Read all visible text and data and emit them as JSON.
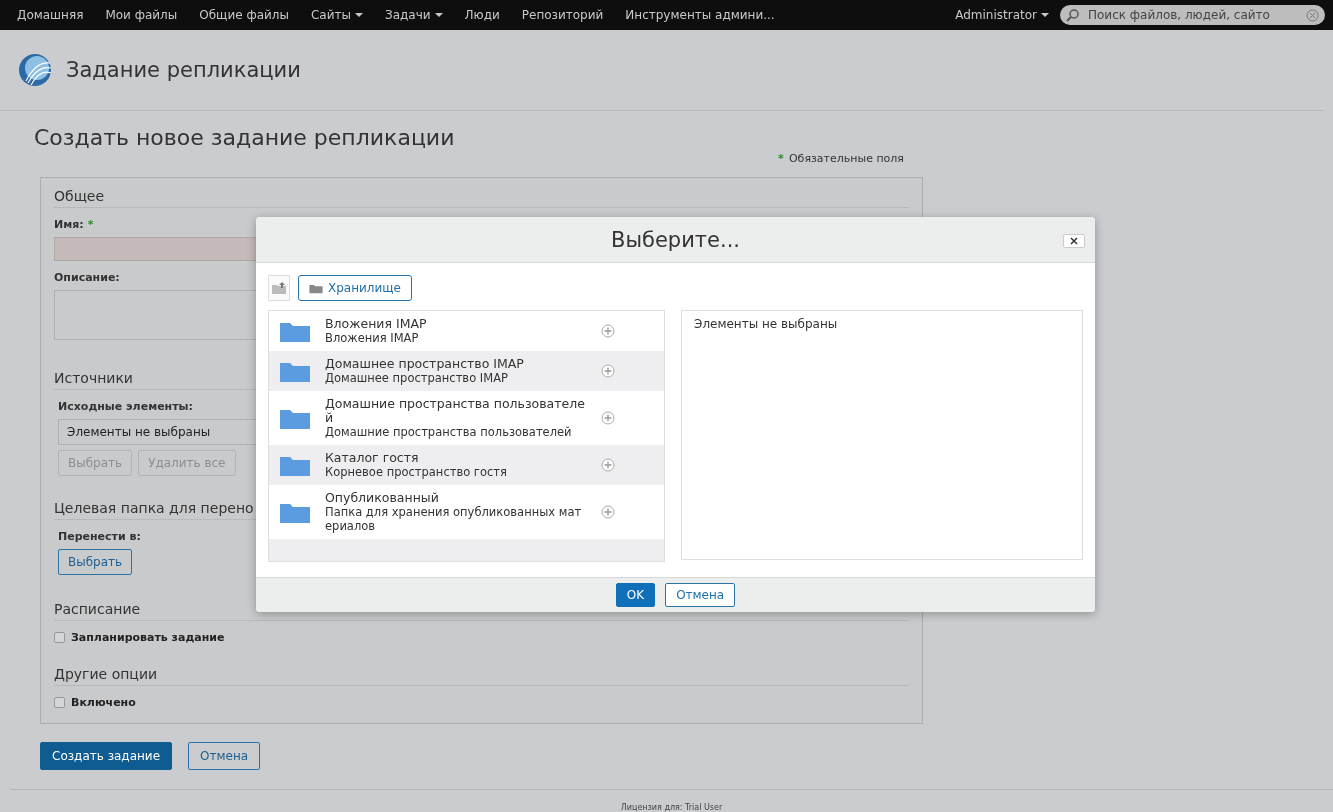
{
  "nav": {
    "items": [
      {
        "label": "Домашняя",
        "dropdown": false
      },
      {
        "label": "Мои файлы",
        "dropdown": false
      },
      {
        "label": "Общие файлы",
        "dropdown": false
      },
      {
        "label": "Сайты",
        "dropdown": true
      },
      {
        "label": "Задачи",
        "dropdown": true
      },
      {
        "label": "Люди",
        "dropdown": false
      },
      {
        "label": "Репозиторий",
        "dropdown": false
      },
      {
        "label": "Инструменты админи...",
        "dropdown": false
      }
    ],
    "user": {
      "label": "Administrator",
      "dropdown": true
    },
    "search": {
      "placeholder": "Поиск файлов, людей, сайто"
    }
  },
  "header": {
    "title": "Задание репликации"
  },
  "page": {
    "title": "Создать новое задание репликации",
    "required_mark": "*",
    "required_note": "Обязательные поля"
  },
  "form": {
    "general": {
      "heading": "Общее",
      "name_label": "Имя:",
      "name_required_mark": "*",
      "description_label": "Описание:"
    },
    "sources": {
      "heading": "Источники",
      "label": "Исходные элементы:",
      "value": "Элементы не выбраны",
      "buttons": [
        {
          "label": "Выбрать",
          "disabled": true
        },
        {
          "label": "Удалить все",
          "disabled": true
        }
      ]
    },
    "target": {
      "heading": "Целевая папка для перено",
      "label": "Перенести в:",
      "button": "Выбрать"
    },
    "schedule": {
      "heading": "Расписание",
      "checkbox": {
        "label": "Запланировать задание",
        "checked": false
      }
    },
    "other": {
      "heading": "Другие опции",
      "checkbox": {
        "label": "Включено",
        "checked": false
      }
    }
  },
  "actions": [
    {
      "label": "Создать задание",
      "kind": "primary"
    },
    {
      "label": "Отмена",
      "kind": "secondary"
    }
  ],
  "dialog": {
    "title": "Выберите...",
    "location_button": "Хранилище",
    "items": [
      {
        "title": "Вложения IMAP",
        "subtitle": "Вложения IMAP"
      },
      {
        "title": "Домашнее пространство IMAP",
        "subtitle": "Домашнее пространство IMAP"
      },
      {
        "title": "Домашние пространства пользователей",
        "subtitle": "Домашние пространства пользователей"
      },
      {
        "title": "Каталог гостя",
        "subtitle": "Корневое пространство гостя"
      },
      {
        "title": "Опубликованный",
        "subtitle": "Папка для хранения опубликованных материалов"
      }
    ],
    "selection_empty": "Элементы не выбраны",
    "buttons": [
      {
        "label": "OK",
        "kind": "primary"
      },
      {
        "label": "Отмена",
        "kind": "secondary"
      }
    ]
  },
  "footer": {
    "license": "Лицензия для: Trial User"
  }
}
